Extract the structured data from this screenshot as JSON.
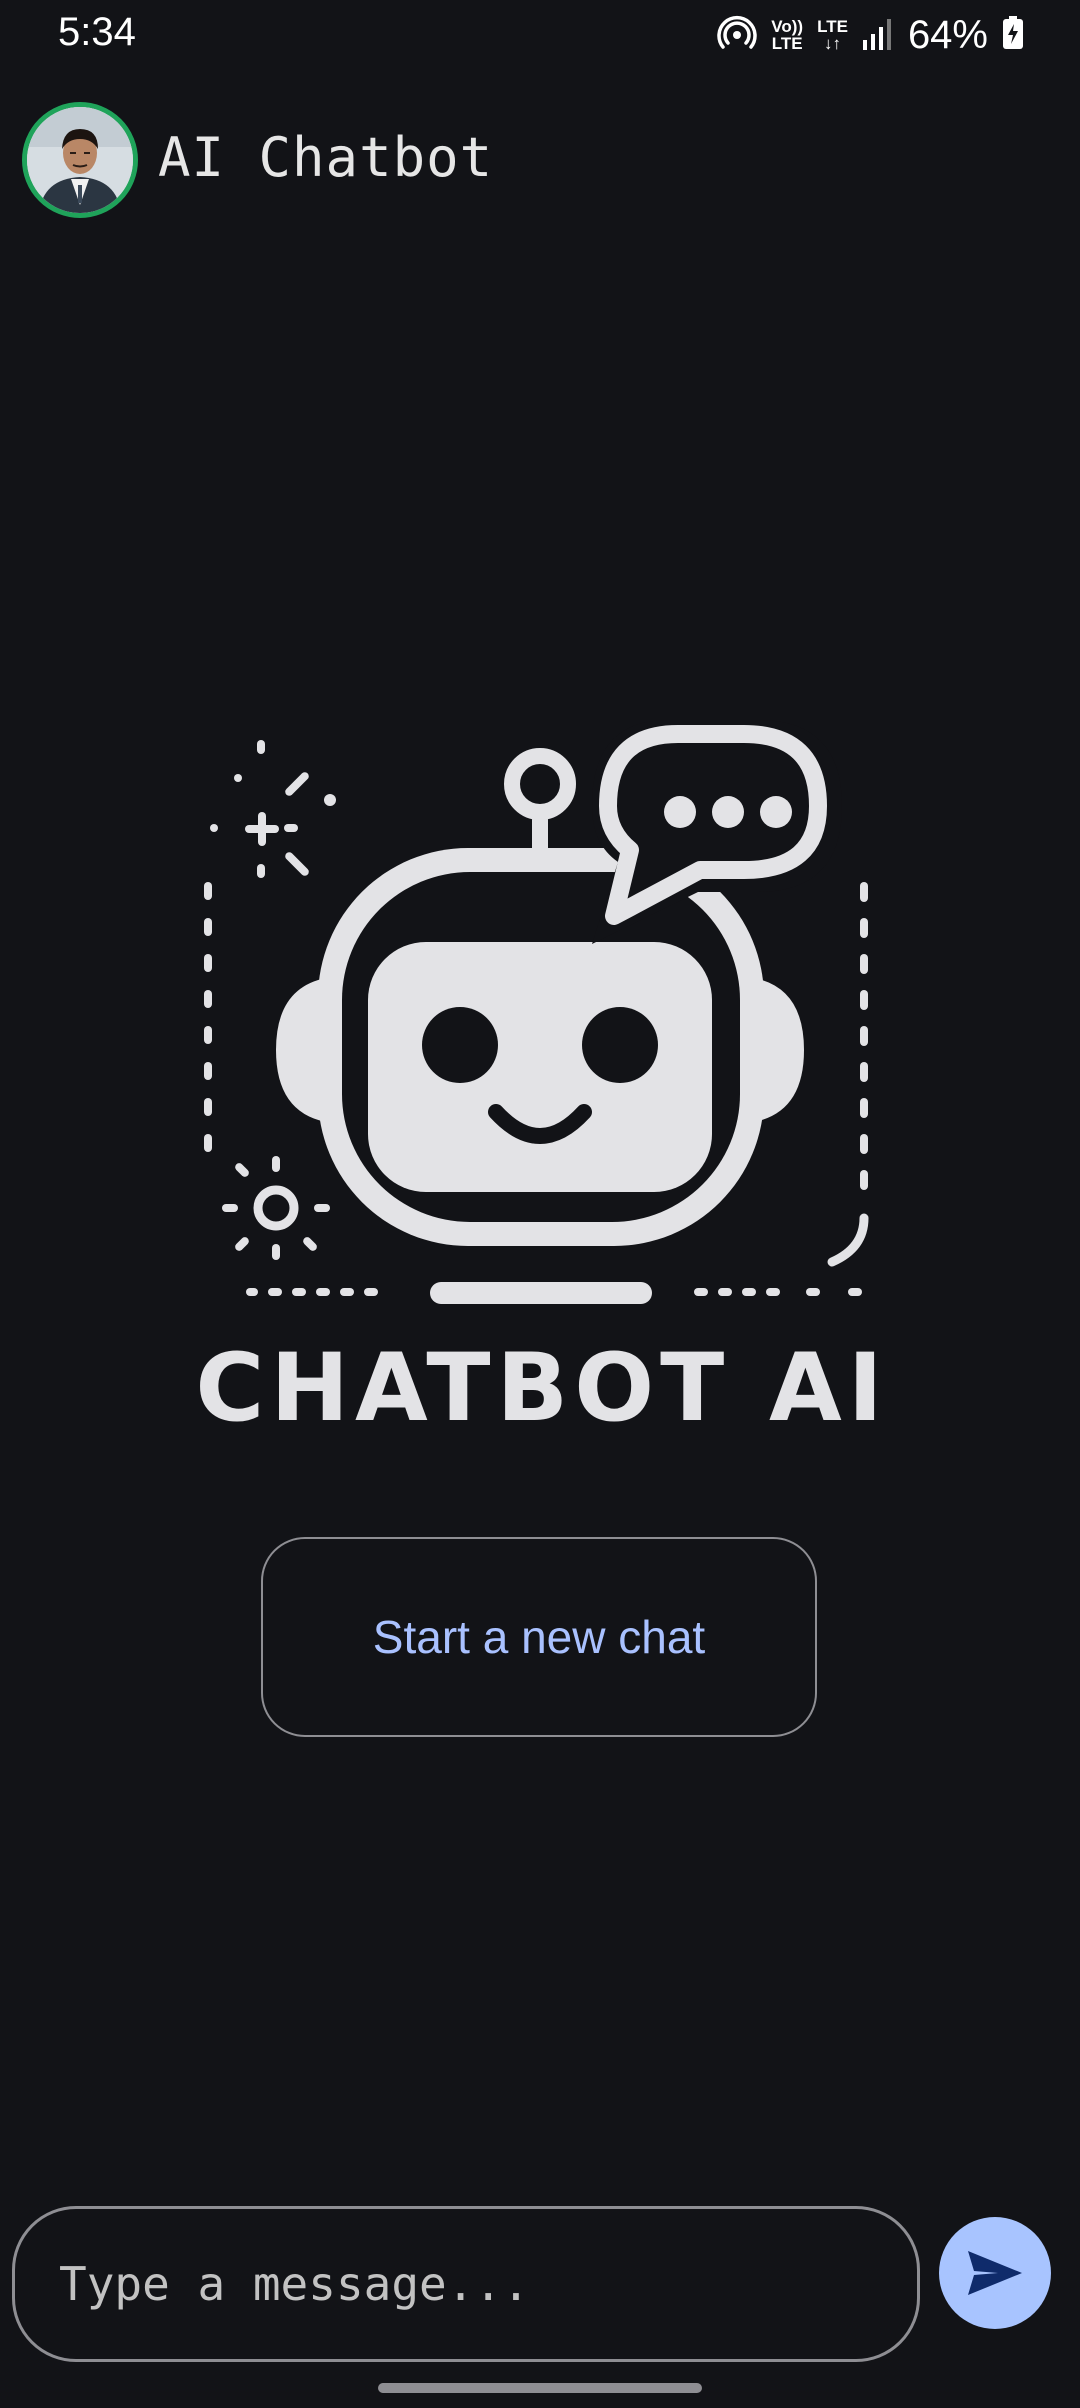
{
  "status_bar": {
    "time": "5:34",
    "volte_top": "Vo))",
    "volte_bottom": "LTE",
    "lte_top": "LTE",
    "lte_bottom": "↓↑",
    "battery": "64%"
  },
  "app_bar": {
    "title": "AI Chatbot",
    "avatar_icon": "user-avatar-photo"
  },
  "logo": {
    "text": "CHATBOT AI",
    "icon": "robot-chat-bubble-logo"
  },
  "main": {
    "start_chat_label": "Start a new chat"
  },
  "composer": {
    "placeholder": "Type a message...",
    "send_icon": "send-arrow-icon"
  },
  "colors": {
    "background": "#121317",
    "accent": "#a8c4ff",
    "avatar_ring": "#1fa35a",
    "logo": "#e3e3e6"
  }
}
